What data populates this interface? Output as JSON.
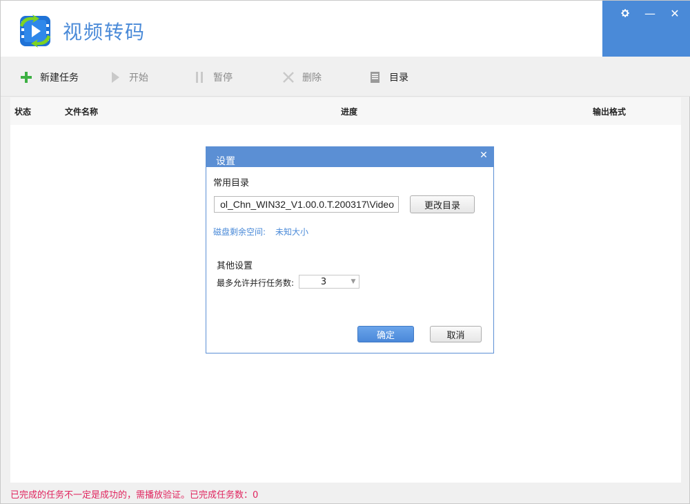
{
  "app": {
    "title": "视频转码"
  },
  "window_controls": {
    "settings_icon": "gear-icon",
    "minimize": "—",
    "close": "✕"
  },
  "toolbar": {
    "new_task": "新建任务",
    "start": "开始",
    "pause": "暂停",
    "delete": "删除",
    "directory": "目录"
  },
  "table": {
    "columns": [
      "状态",
      "文件名称",
      "进度",
      "输出格式"
    ]
  },
  "status_bar": {
    "text": "已完成的任务不一定是成功的，需播放验证。已完成任务数：0"
  },
  "dialog": {
    "title": "设置",
    "close": "✕",
    "common_dir_label": "常用目录",
    "dir_value": "ol_Chn_WIN32_V1.00.0.T.200317\\Video",
    "change_dir_button": "更改目录",
    "disk_space_label": "磁盘剩余空间:",
    "disk_space_value": "未知大小",
    "other_settings_label": "其他设置",
    "max_tasks_label": "最多允许并行任务数:",
    "max_tasks_value": "3",
    "ok_button": "确定",
    "cancel_button": "取消"
  },
  "colors": {
    "accent": "#4a8ad8",
    "dialog_title": "#5b8fd4",
    "status_text": "#e0245e",
    "new_task_plus": "#3cb043"
  }
}
